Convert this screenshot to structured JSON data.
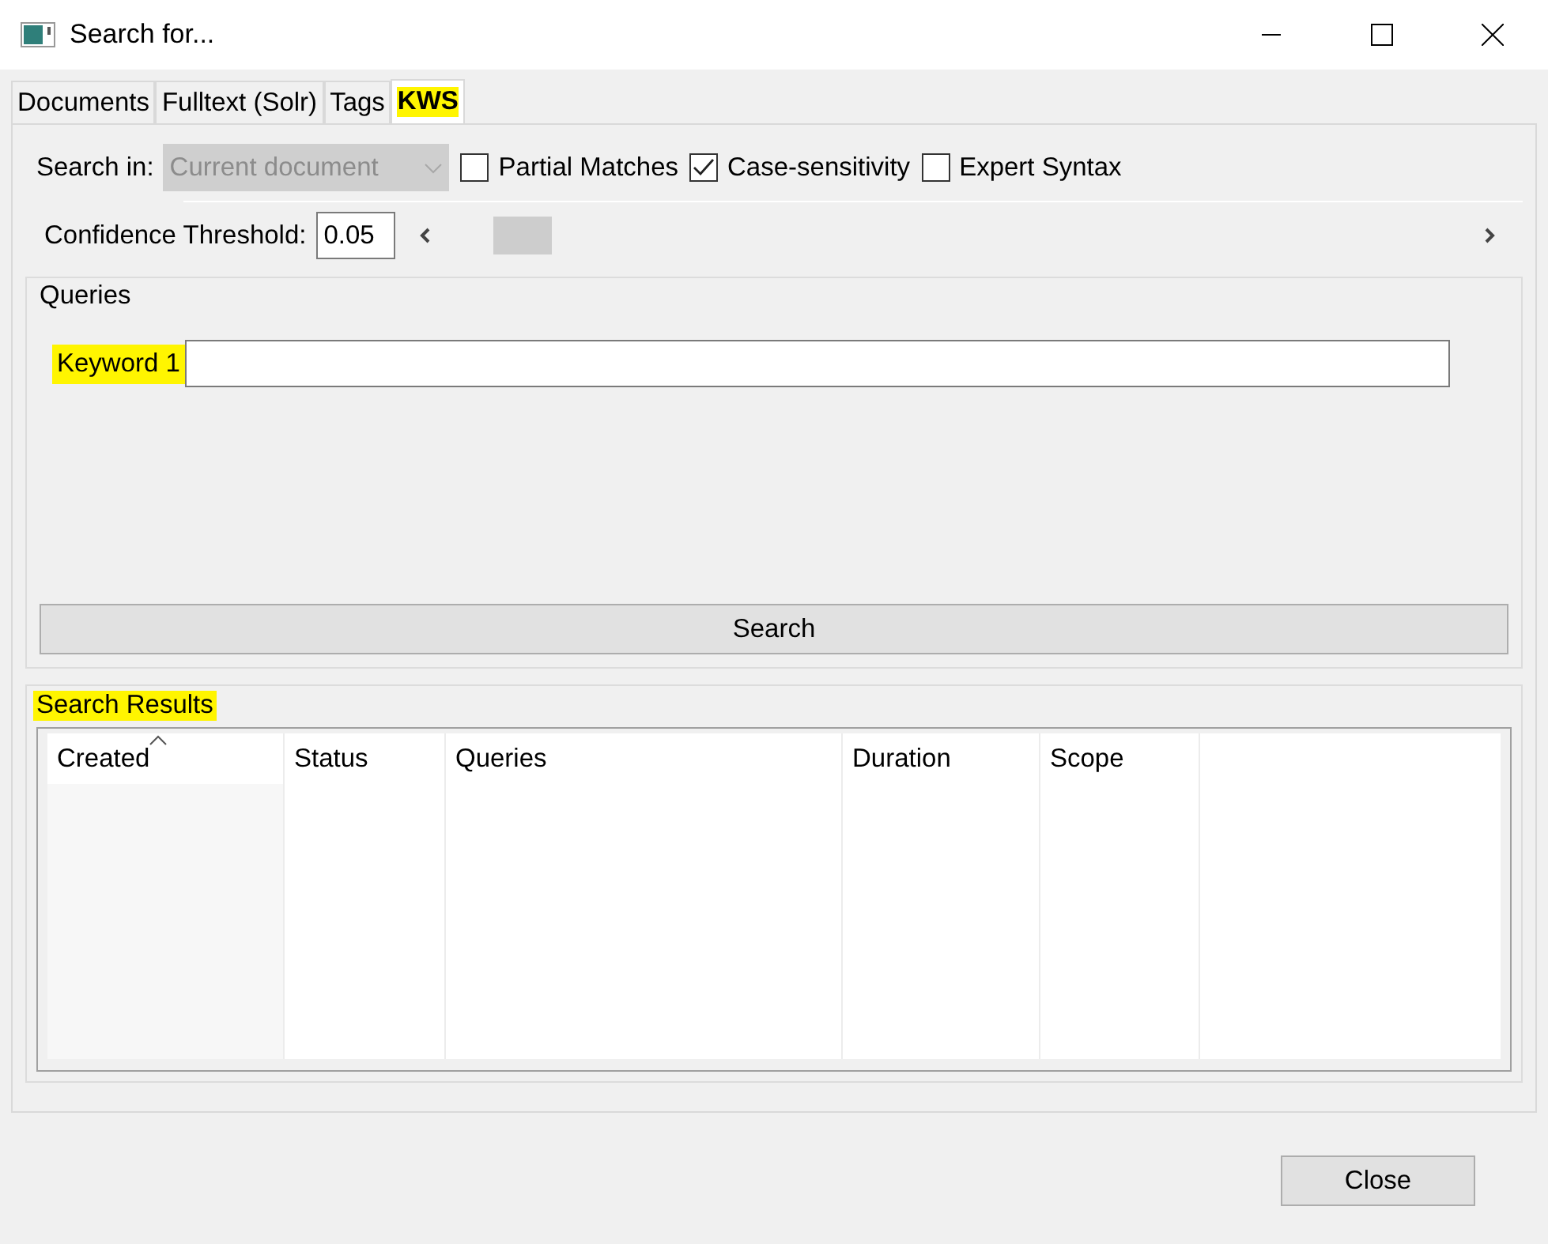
{
  "window": {
    "title": "Search for..."
  },
  "tabs": [
    {
      "label": "Documents",
      "selected": false,
      "highlighted": false
    },
    {
      "label": "Fulltext (Solr)",
      "selected": false,
      "highlighted": false
    },
    {
      "label": "Tags",
      "selected": false,
      "highlighted": false
    },
    {
      "label": "KWS",
      "selected": true,
      "highlighted": true
    }
  ],
  "search_in": {
    "label": "Search in:",
    "value": "Current document",
    "disabled": true
  },
  "options": [
    {
      "label": "Partial Matches",
      "checked": false
    },
    {
      "label": "Case-sensitivity",
      "checked": true
    },
    {
      "label": "Expert Syntax",
      "checked": false
    }
  ],
  "confidence": {
    "label": "Confidence Threshold:",
    "value": "0.05",
    "level": 0.05
  },
  "queries": {
    "title": "Queries",
    "fields": [
      {
        "label": "Keyword 1",
        "highlighted": true
      }
    ],
    "button": "Search"
  },
  "results": {
    "title": "Search Results",
    "highlighted": true,
    "columns": [
      {
        "label": "Created",
        "sorted": true
      },
      {
        "label": "Status",
        "sorted": false
      },
      {
        "label": "Queries",
        "sorted": false
      },
      {
        "label": "Duration",
        "sorted": false
      },
      {
        "label": "Scope",
        "sorted": false
      }
    ]
  },
  "buttons": [
    "Close"
  ]
}
